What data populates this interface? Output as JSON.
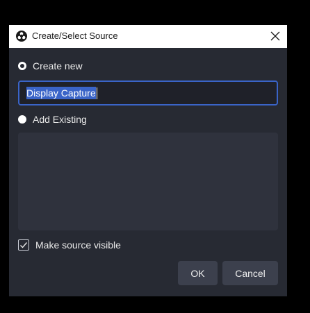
{
  "dialog": {
    "title": "Create/Select Source",
    "icon": "obs-logo-icon"
  },
  "create_new": {
    "label": "Create new",
    "selected": true,
    "name_value": "Display Capture"
  },
  "add_existing": {
    "label": "Add Existing",
    "selected": false,
    "items": []
  },
  "make_visible": {
    "label": "Make source visible",
    "checked": true
  },
  "buttons": {
    "ok": "OK",
    "cancel": "Cancel"
  },
  "colors": {
    "dialog_bg": "#272a33",
    "accent": "#3a64c8",
    "button_bg": "#3c404d",
    "list_bg": "#2f323d"
  }
}
